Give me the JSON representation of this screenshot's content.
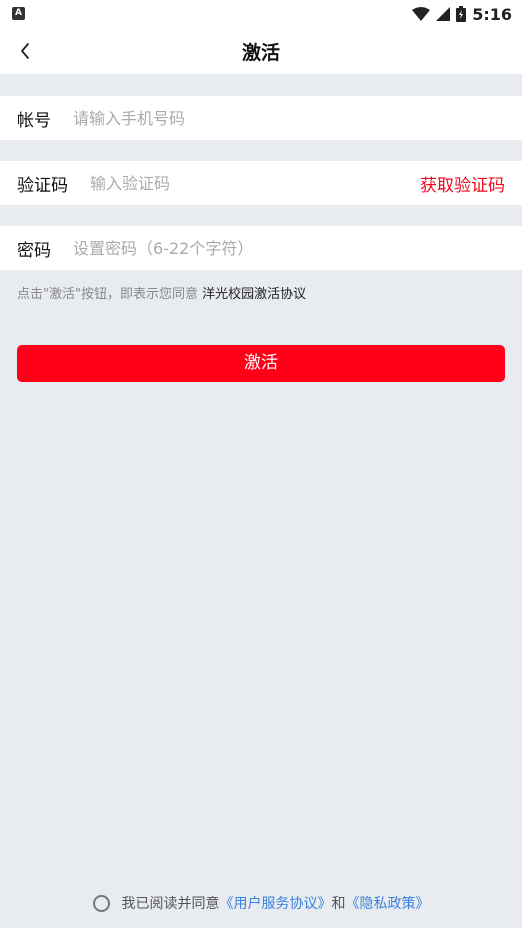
{
  "status_bar": {
    "left_icon": "A",
    "time": "5:16",
    "icons": [
      "wifi-icon",
      "signal-icon",
      "battery-icon"
    ]
  },
  "header": {
    "back_icon": "chevron-left-icon",
    "title": "激活"
  },
  "form": {
    "account": {
      "label": "帐号",
      "placeholder": "请输入手机号码",
      "value": ""
    },
    "code": {
      "label": "验证码",
      "placeholder": "输入验证码",
      "value": "",
      "get_code_label": "获取验证码"
    },
    "password": {
      "label": "密码",
      "placeholder": "设置密码（6-22个字符）",
      "value": ""
    }
  },
  "agreement_note": {
    "prefix": "点击\"激活\"按钮，即表示您同意 ",
    "link": "洋光校园激活协议"
  },
  "activate_button": {
    "label": "激活"
  },
  "bottom_agreement": {
    "prefix": "我已阅读并同意",
    "user_agreement": "《用户服务协议》",
    "conjunction": "和",
    "privacy_policy": "《隐私政策》"
  },
  "colors": {
    "accent_red": "#ff0018",
    "link_blue": "#3b82dc",
    "background": "#e8ebef"
  }
}
